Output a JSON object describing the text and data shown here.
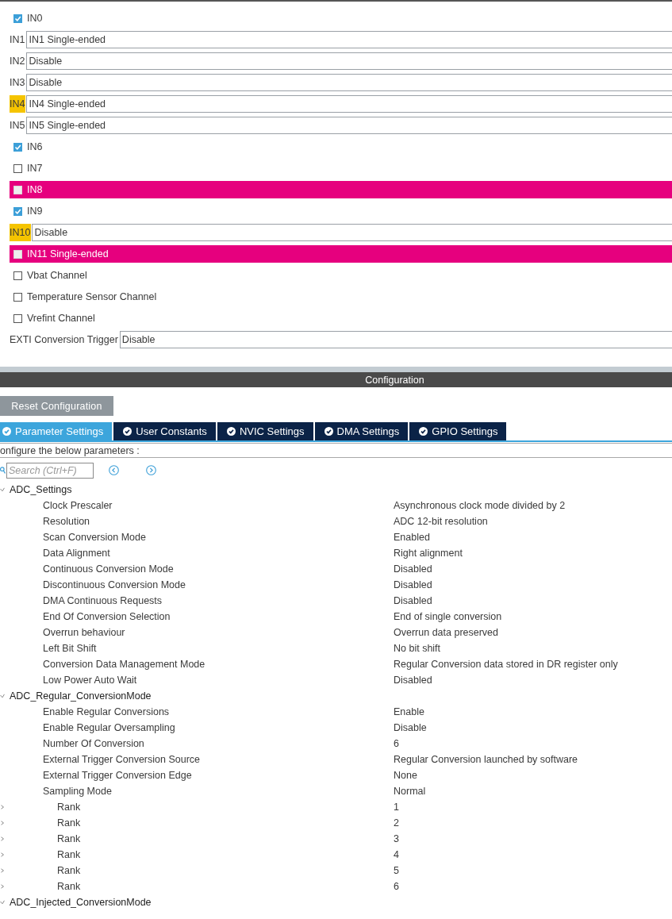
{
  "channel_modes": [
    {
      "kind": "checkbox",
      "label": "IN0",
      "checked": true,
      "conflict": false
    },
    {
      "kind": "select",
      "label": "IN1",
      "value": "IN1 Single-ended",
      "warning": false
    },
    {
      "kind": "select",
      "label": "IN2",
      "value": "Disable",
      "warning": false
    },
    {
      "kind": "select",
      "label": "IN3",
      "value": "Disable",
      "warning": false
    },
    {
      "kind": "select",
      "label": "IN4",
      "value": "IN4 Single-ended",
      "warning": true
    },
    {
      "kind": "select",
      "label": "IN5",
      "value": "IN5 Single-ended",
      "warning": false
    },
    {
      "kind": "checkbox",
      "label": "IN6",
      "checked": true,
      "conflict": false
    },
    {
      "kind": "checkbox",
      "label": "IN7",
      "checked": false,
      "conflict": false
    },
    {
      "kind": "checkbox",
      "label": "IN8",
      "checked": false,
      "conflict": true
    },
    {
      "kind": "checkbox",
      "label": "IN9",
      "checked": true,
      "conflict": false
    },
    {
      "kind": "select",
      "label": "IN10",
      "value": "Disable",
      "warning": true
    },
    {
      "kind": "checkbox",
      "label": "IN11 Single-ended",
      "checked": false,
      "conflict": true
    },
    {
      "kind": "checkbox",
      "label": "Vbat Channel",
      "checked": false,
      "conflict": false
    },
    {
      "kind": "checkbox",
      "label": "Temperature Sensor Channel",
      "checked": false,
      "conflict": false
    },
    {
      "kind": "checkbox",
      "label": "Vrefint Channel",
      "checked": false,
      "conflict": false
    },
    {
      "kind": "select",
      "label": "EXTI Conversion Trigger",
      "value": "Disable",
      "warning": false
    }
  ],
  "configuration": {
    "title": "Configuration",
    "reset_button": "Reset Configuration",
    "tabs": [
      {
        "label": "Parameter Settings",
        "selected": true
      },
      {
        "label": "User Constants",
        "selected": false
      },
      {
        "label": "NVIC Settings",
        "selected": false
      },
      {
        "label": "DMA Settings",
        "selected": false
      },
      {
        "label": "GPIO Settings",
        "selected": false
      }
    ],
    "instruction": "onfigure the below parameters :",
    "search": {
      "placeholder": "Search (Ctrl+F)"
    },
    "tree": [
      {
        "label": "ADC_Settings",
        "expanded": true,
        "children": [
          {
            "label": "Clock Prescaler",
            "value": "Asynchronous clock mode divided by 2"
          },
          {
            "label": "Resolution",
            "value": "ADC 12-bit resolution"
          },
          {
            "label": "Scan Conversion Mode",
            "value": "Enabled"
          },
          {
            "label": "Data Alignment",
            "value": "Right alignment"
          },
          {
            "label": "Continuous Conversion Mode",
            "value": "Disabled"
          },
          {
            "label": "Discontinuous Conversion Mode",
            "value": "Disabled"
          },
          {
            "label": "DMA Continuous Requests",
            "value": "Disabled"
          },
          {
            "label": "End Of Conversion Selection",
            "value": "End of single conversion"
          },
          {
            "label": "Overrun behaviour",
            "value": "Overrun data preserved"
          },
          {
            "label": "Left Bit Shift",
            "value": "No bit shift"
          },
          {
            "label": "Conversion Data Management Mode",
            "value": "Regular Conversion data stored in DR register only"
          },
          {
            "label": "Low Power Auto Wait",
            "value": "Disabled"
          }
        ]
      },
      {
        "label": "ADC_Regular_ConversionMode",
        "expanded": true,
        "children": [
          {
            "label": "Enable Regular Conversions",
            "value": "Enable"
          },
          {
            "label": "Enable Regular Oversampling",
            "value": "Disable"
          },
          {
            "label": "Number Of Conversion",
            "value": "6"
          },
          {
            "label": "External Trigger Conversion Source",
            "value": "Regular Conversion launched by software"
          },
          {
            "label": "External Trigger Conversion Edge",
            "value": "None"
          },
          {
            "label": "Sampling Mode",
            "value": "Normal"
          },
          {
            "label": "Rank",
            "value": "1",
            "expanded": false
          },
          {
            "label": "Rank",
            "value": "2",
            "expanded": false
          },
          {
            "label": "Rank",
            "value": "3",
            "expanded": false
          },
          {
            "label": "Rank",
            "value": "4",
            "expanded": false
          },
          {
            "label": "Rank",
            "value": "5",
            "expanded": false
          },
          {
            "label": "Rank",
            "value": "6",
            "expanded": false
          }
        ]
      },
      {
        "label": "ADC_Injected_ConversionMode",
        "expanded": true
      }
    ]
  }
}
